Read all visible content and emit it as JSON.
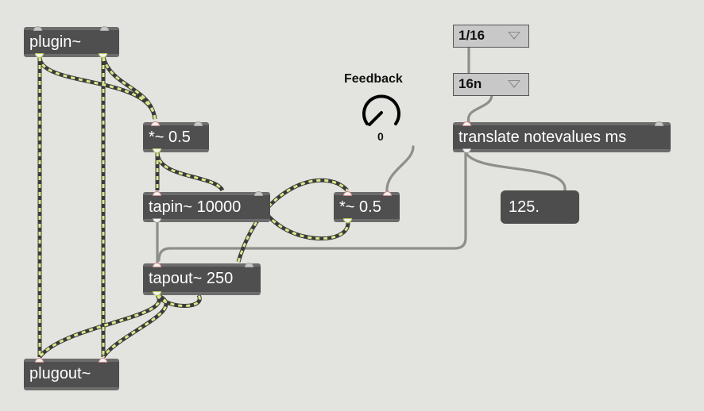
{
  "objects": {
    "plugin": "plugin~",
    "mul_top": "*~ 0.5",
    "tapin": "tapin~ 10000",
    "mul_fb": "*~ 0.5",
    "tapout": "tapout~ 250",
    "plugout": "plugout~",
    "translate": "translate notevalues ms"
  },
  "menus": {
    "notevalue": "1/16",
    "tick": "16n"
  },
  "dial": {
    "label": "Feedback",
    "value": "0"
  },
  "number_box": {
    "value": "125."
  },
  "colors": {
    "background": "#e3e3df",
    "object_fill": "#4f4f4f",
    "signal_cable_dash": "#dbe88a",
    "signal_cable_base": "#3a3a3a",
    "control_cable": "#9a9a98"
  }
}
